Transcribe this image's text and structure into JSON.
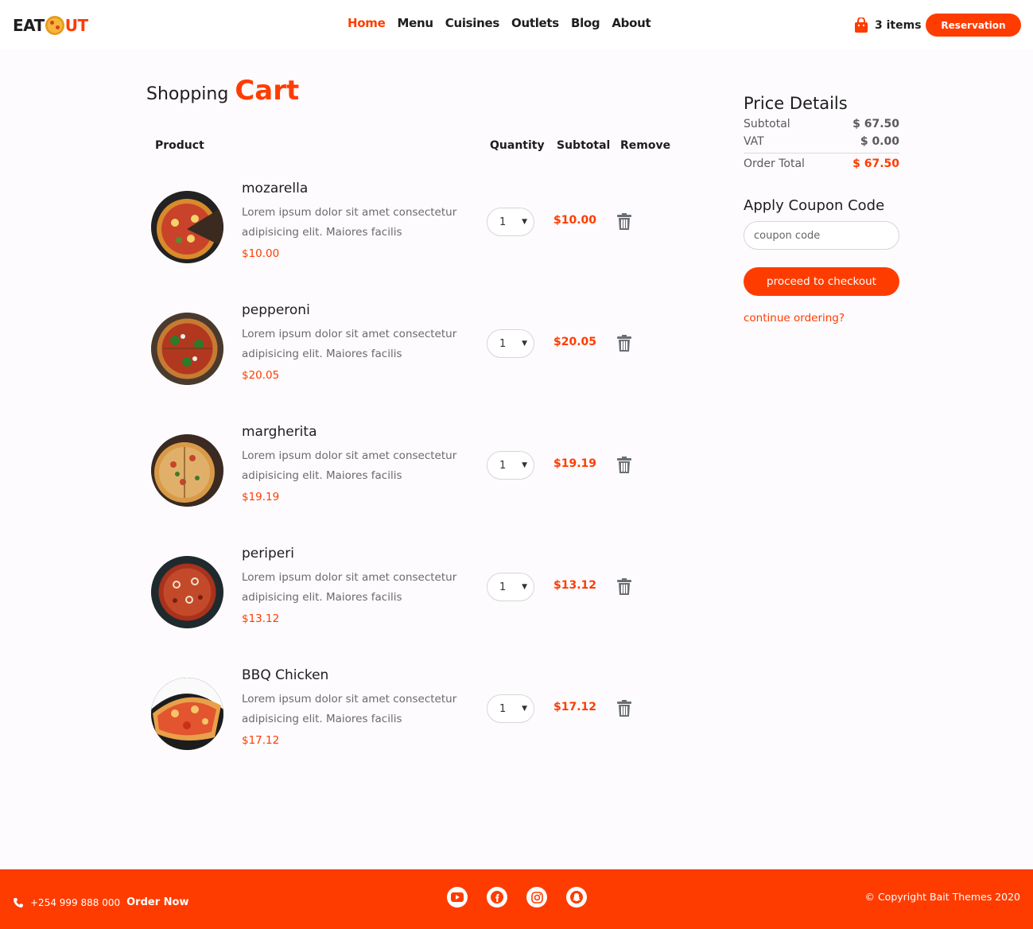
{
  "brand": {
    "logo_left": "EAT",
    "logo_right": "UT"
  },
  "nav": {
    "items": [
      {
        "label": "Home",
        "active": true
      },
      {
        "label": "Menu",
        "active": false
      },
      {
        "label": "Cuisines",
        "active": false
      },
      {
        "label": "Outlets",
        "active": false
      },
      {
        "label": "Blog",
        "active": false
      },
      {
        "label": "About",
        "active": false
      }
    ],
    "cart_count": "3 items",
    "reservation_label": "Reservation"
  },
  "page": {
    "title_light": "Shopping",
    "title_bold": "Cart"
  },
  "table": {
    "headers": {
      "product": "Product",
      "quantity": "Quantity",
      "subtotal": "Subtotal",
      "remove": "Remove"
    },
    "rows": [
      {
        "name": "mozarella",
        "desc": "Lorem ipsum dolor sit amet consectetur adipisicing elit. Maiores facilis",
        "price": "$10.00",
        "qty": "1",
        "subtotal": "$10.00"
      },
      {
        "name": "pepperoni",
        "desc": "Lorem ipsum dolor sit amet consectetur adipisicing elit. Maiores facilis",
        "price": "$20.05",
        "qty": "1",
        "subtotal": "$20.05"
      },
      {
        "name": "margherita",
        "desc": "Lorem ipsum dolor sit amet consectetur adipisicing elit. Maiores facilis",
        "price": "$19.19",
        "qty": "1",
        "subtotal": "$19.19"
      },
      {
        "name": "periperi",
        "desc": "Lorem ipsum dolor sit amet consectetur adipisicing elit. Maiores facilis",
        "price": "$13.12",
        "qty": "1",
        "subtotal": "$13.12"
      },
      {
        "name": "BBQ Chicken",
        "desc": "Lorem ipsum dolor sit amet consectetur adipisicing elit. Maiores facilis",
        "price": "$17.12",
        "qty": "1",
        "subtotal": "$17.12"
      }
    ]
  },
  "price_details": {
    "title": "Price Details",
    "subtotal_label": "Subtotal",
    "subtotal_value": "$ 67.50",
    "vat_label": "VAT",
    "vat_value": "$ 0.00",
    "total_label": "Order Total",
    "total_value": "$ 67.50"
  },
  "coupon": {
    "title": "Apply Coupon Code",
    "placeholder": "coupon code",
    "checkout_label": "proceed to checkout",
    "continue_label": "continue ordering?"
  },
  "footer": {
    "phone": "+254 999 888 000",
    "order_now": "Order Now",
    "copyright": "© Copyright Bait Themes 2020"
  },
  "colors": {
    "accent": "#ff3c00",
    "text": "#1e1e1e",
    "muted": "#6b6b6b"
  }
}
